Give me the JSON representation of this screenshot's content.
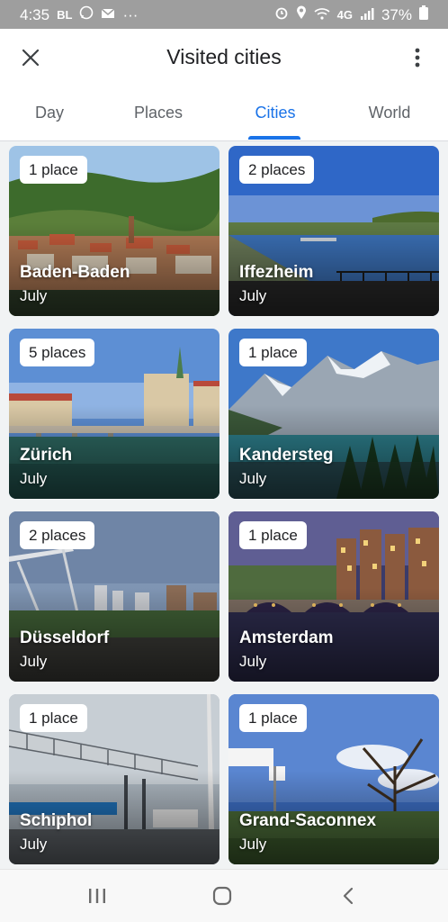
{
  "status_bar": {
    "time": "4:35",
    "carrier": "BL",
    "signal_label": "4G",
    "battery_pct": "37%"
  },
  "header": {
    "title": "Visited cities"
  },
  "tabs": [
    {
      "label": "Day"
    },
    {
      "label": "Places"
    },
    {
      "label": "Cities",
      "active": true
    },
    {
      "label": "World"
    }
  ],
  "cities": [
    {
      "name": "Baden-Baden",
      "count": "1 place",
      "month": "July"
    },
    {
      "name": "Iffezheim",
      "count": "2 places",
      "month": "July"
    },
    {
      "name": "Zürich",
      "count": "5 places",
      "month": "July"
    },
    {
      "name": "Kandersteg",
      "count": "1 place",
      "month": "July"
    },
    {
      "name": "Düsseldorf",
      "count": "2 places",
      "month": "July"
    },
    {
      "name": "Amsterdam",
      "count": "1 place",
      "month": "July"
    },
    {
      "name": "Schiphol",
      "count": "1 place",
      "month": "July"
    },
    {
      "name": "Grand-Saconnex",
      "count": "1 place",
      "month": "July"
    }
  ],
  "nav": {
    "recents_icon": "recents-icon",
    "home_icon": "home-icon",
    "back_icon": "back-icon"
  },
  "colors": {
    "accent": "#1a73e8",
    "status_bar": "#9e9e9e"
  }
}
